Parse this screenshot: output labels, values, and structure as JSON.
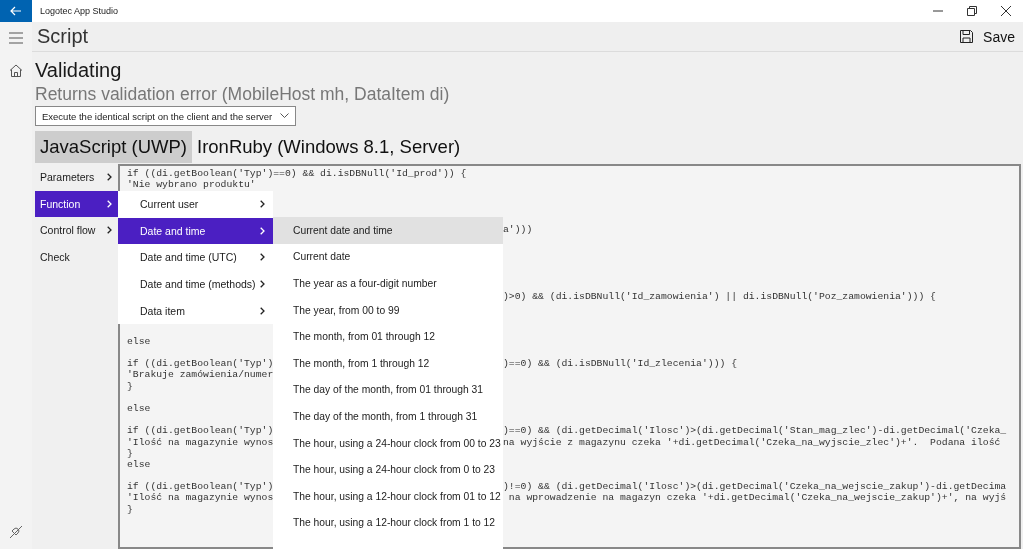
{
  "window": {
    "title": "Logotec App Studio"
  },
  "header": {
    "title": "Script",
    "save_label": "Save"
  },
  "script": {
    "name": "Validating",
    "signature": "Returns validation error (MobileHost mh, DataItem di)",
    "mode": "Execute the identical script on the client and the server"
  },
  "tabs": [
    {
      "label": "JavaScript (UWP)",
      "selected": true
    },
    {
      "label": "IronRuby (Windows 8.1, Server)",
      "selected": false
    }
  ],
  "categories": [
    {
      "label": "Parameters",
      "submenu": true,
      "selected": false
    },
    {
      "label": "Function",
      "submenu": true,
      "selected": true
    },
    {
      "label": "Control flow",
      "submenu": true,
      "selected": false
    },
    {
      "label": "Check",
      "submenu": false,
      "selected": false
    }
  ],
  "function_menu": [
    {
      "label": "Current user",
      "selected": false
    },
    {
      "label": "Date and time",
      "selected": true
    },
    {
      "label": "Date and time (UTC)",
      "selected": false
    },
    {
      "label": "Date and time (methods)",
      "selected": false
    },
    {
      "label": "Data item",
      "selected": false
    }
  ],
  "date_time_menu": [
    {
      "label": "Current date and time",
      "selected": true
    },
    {
      "label": "Current date",
      "selected": false
    },
    {
      "label": "The year as a four-digit number",
      "selected": false
    },
    {
      "label": "The year, from 00 to 99",
      "selected": false
    },
    {
      "label": "The month, from 01 through 12",
      "selected": false
    },
    {
      "label": "The month, from 1 through 12",
      "selected": false
    },
    {
      "label": "The day of the month, from 01 through 31",
      "selected": false
    },
    {
      "label": "The day of the month, from 1 through 31",
      "selected": false
    },
    {
      "label": "The hour, using a 24-hour clock from 00 to 23",
      "selected": false
    },
    {
      "label": "The hour, using a 24-hour clock from 0 to 23",
      "selected": false
    },
    {
      "label": "The hour, using a 12-hour clock from 01 to 12",
      "selected": false
    },
    {
      "label": "The hour, using a 12-hour clock from 1 to 12",
      "selected": false
    }
  ],
  "code_lines": [
    {
      "kind": "full",
      "text": "if ((di.getBoolean('Typ')==0) && di.isDBNull('Id_prod')) {"
    },
    {
      "kind": "full",
      "text": "'Nie wybrano produktu'"
    },
    {
      "kind": "blank"
    },
    {
      "kind": "blank"
    },
    {
      "kind": "blank"
    },
    {
      "kind": "split",
      "right": "a')))"
    },
    {
      "kind": "blank"
    },
    {
      "kind": "blank"
    },
    {
      "kind": "blank"
    },
    {
      "kind": "blank"
    },
    {
      "kind": "blank"
    },
    {
      "kind": "split",
      "right": ")>0) && (di.isDBNull('Id_zamowienia') || di.isDBNull('Poz_zamowienia'))) {"
    },
    {
      "kind": "blank"
    },
    {
      "kind": "blank"
    },
    {
      "kind": "blank"
    },
    {
      "kind": "full",
      "text": "else"
    },
    {
      "kind": "blank"
    },
    {
      "kind": "split",
      "left": "if ((di.getBoolean('Typ')",
      "right": ")==0) && (di.isDBNull('Id_zlecenia'))) {"
    },
    {
      "kind": "split",
      "left": "'Brakuje zamówienia/numer"
    },
    {
      "kind": "full",
      "text": "}"
    },
    {
      "kind": "blank"
    },
    {
      "kind": "full",
      "text": "else"
    },
    {
      "kind": "blank"
    },
    {
      "kind": "split",
      "left": "if ((di.getBoolean('Typ')",
      "right": ")==0) && (di.getDecimal('Ilosc')>(di.getDecimal('Stan_mag_zlec')-di.getDecimal('Czeka_"
    },
    {
      "kind": "split",
      "left": "'Ilość na magazynie wynos",
      "right": "na wyjście z magazynu czeka '+di.getDecimal('Czeka_na_wyjscie_zlec')+'.  Podana ilość"
    },
    {
      "kind": "full",
      "text": "}"
    },
    {
      "kind": "full",
      "text": "else"
    },
    {
      "kind": "blank"
    },
    {
      "kind": "split",
      "left": "if ((di.getBoolean('Typ')",
      "right": ")!=0) && (di.getDecimal('Ilosc')>(di.getDecimal('Czeka_na_wejscie_zakup')-di.getDecima"
    },
    {
      "kind": "split",
      "left": "'Ilość na magazynie wynos",
      "right": " na wprowadzenie na magazyn czeka '+di.getDecimal('Czeka_na_wejscie_zakup')+', na wyjś"
    },
    {
      "kind": "full",
      "text": "}"
    }
  ]
}
